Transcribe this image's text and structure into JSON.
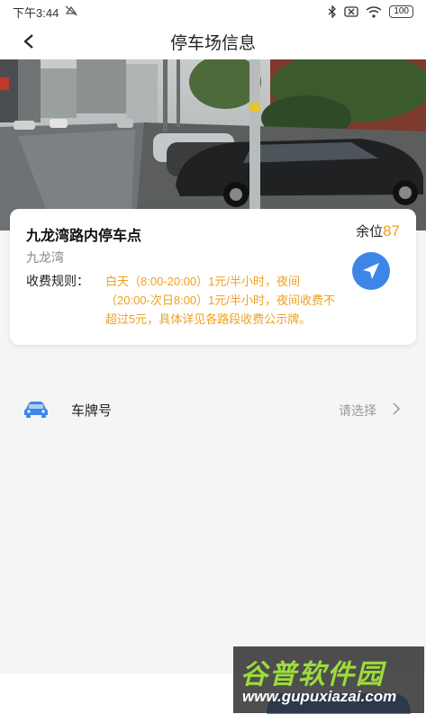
{
  "status_bar": {
    "time": "下午3:44",
    "battery": "100"
  },
  "header": {
    "title": "停车场信息"
  },
  "parking": {
    "name": "九龙湾路内停车点",
    "vacancy_label": "余位",
    "vacancy_count": "87",
    "area": "九龙湾",
    "rule_label": "收费规则：",
    "rule_text": "白天（8:00-20:00）1元/半小时，夜间（20:00-次日8:00）1元/半小时，夜间收费不超过5元，具体详见各路段收费公示牌。"
  },
  "plate": {
    "label": "车牌号",
    "value": "请选择"
  },
  "watermark": {
    "title": "谷普软件园",
    "url": "www.gupuxiazai.com"
  },
  "colors": {
    "accent": "#3d86e8",
    "highlight": "#f0a020"
  },
  "icons": {
    "back": "back-arrow-icon",
    "navigate": "navigate-arrow-icon",
    "car": "car-icon",
    "chevron": "chevron-right-icon"
  }
}
